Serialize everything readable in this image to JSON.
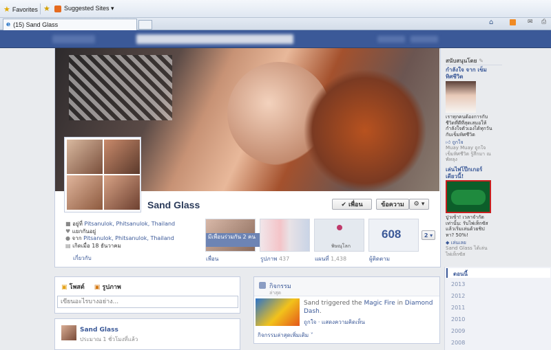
{
  "browser": {
    "favorites_label": "Favorites",
    "suggested_sites_label": "Suggested Sites ▾",
    "tab_title": "(15) Sand Glass"
  },
  "profile": {
    "name": "Sand Glass",
    "friend_button": "✔ เพื่อน",
    "message_button": "ข้อความ",
    "gear_button": "⚙ ▾",
    "info": {
      "lives_prefix": "อยู่ที่ ",
      "lives_link": "Pitsanulok, Phitsanulok, Thailand",
      "status": "แยกกันอยู่",
      "from_prefix": "จาก ",
      "from_link": "Pitsanulok, Phitsanulok, Thailand",
      "born": "เกิดเมื่อ 18 ธันวาคม",
      "about_link": "เกี่ยวกับ"
    },
    "tiles": {
      "mutual_friends": "มีเพื่อนร่วมกัน 2 คน",
      "friends_label": "เพื่อน",
      "photos_label": "รูปภาพ",
      "photos_count": "437",
      "map_place": "พิษณุโลก",
      "map_label": "แผนที่",
      "map_count": "1,438",
      "followers_count": "608",
      "followers_label": "ผู้ติดตาม",
      "more_count": "2 ▾"
    }
  },
  "composer": {
    "tab_post": "โพสต์",
    "tab_photo": "รูปภาพ",
    "placeholder": "เขียนอะไรบางอย่าง..."
  },
  "post": {
    "author": "Sand Glass",
    "time": "ประมาณ 1 ชั่วโมงที่แล้ว"
  },
  "activity": {
    "title": "กิจกรรม",
    "subtitle": "ล่าสุด",
    "actor": "Sand",
    "text_mid": " triggered the ",
    "item_link": "Magic Fire",
    "text_in": " in ",
    "game_link": "Diamond Dash",
    "period": ".",
    "actions": "ถูกใจ · แสดงความคิดเห็น",
    "more_link": "กิจกรรมล่าสุดเพิ่มเติม ˅"
  },
  "sponsored": {
    "header": "สนับสนุนโดย",
    "ad1_title": "กำลังใจ จาก เข็มทิศชีวิต",
    "ad1_text": "เราทุกคนต้องการกับชีวิตที่ดีที่สุดเสมอให้กำลังใจตัวเองได้ทุกวันกับเข็มทิศชีวิต",
    "ad1_like": "ถูกใจ",
    "ad1_social": "Muay Muay ถูกใจ เข็มทิศชีวิต รู้สึกมา ณ พัทลุง",
    "ad2_title": "เล่นไพ่โป๊กเกอร์เดียวนี้!",
    "ad2_text": "ปูวเข้า! เวลาจำกัดเท่านั้น: รับไพ่เท็กซัสแล้วเริ่มเล่นด้วยชิปหา? 50%!",
    "ad2_play": "เล่นเลย",
    "ad2_social": "Sand Glass ได้เล่น ไพ่เท็กซัส"
  },
  "timeline": {
    "current": "ตอนนี้",
    "years": [
      "2013",
      "2012",
      "2011",
      "2010",
      "2009",
      "2008"
    ]
  }
}
